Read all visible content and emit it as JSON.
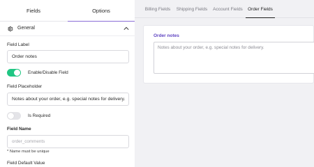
{
  "left_panel": {
    "tabs": {
      "fields": "Fields",
      "options": "Options"
    },
    "section_title": "General",
    "field_label": {
      "label": "Field Label",
      "value": "Order notes"
    },
    "enable_toggle": {
      "label": "Enable/Disable Field",
      "on": true
    },
    "field_placeholder": {
      "label": "Field Placeholder",
      "value": "Notes about your order, e.g. special notes for delivery."
    },
    "required_toggle": {
      "label": "Is Required",
      "on": false
    },
    "field_name": {
      "label": "Field Name",
      "placeholder": "order_comments",
      "note": "* Name must be unique"
    },
    "default_value_label": "Field Default Value"
  },
  "top_tabs": [
    "Billing Fields",
    "Shipping Fields",
    "Account Fields",
    "Order Fields"
  ],
  "active_top_tab": "Order Fields",
  "preview": {
    "label": "Order notes",
    "placeholder": "Notes about your order, e.g. special notes for delivery."
  },
  "colors": {
    "accent": "#5f44c2",
    "toggle_on": "#20c683",
    "toggle_off": "#e4e4e8"
  }
}
